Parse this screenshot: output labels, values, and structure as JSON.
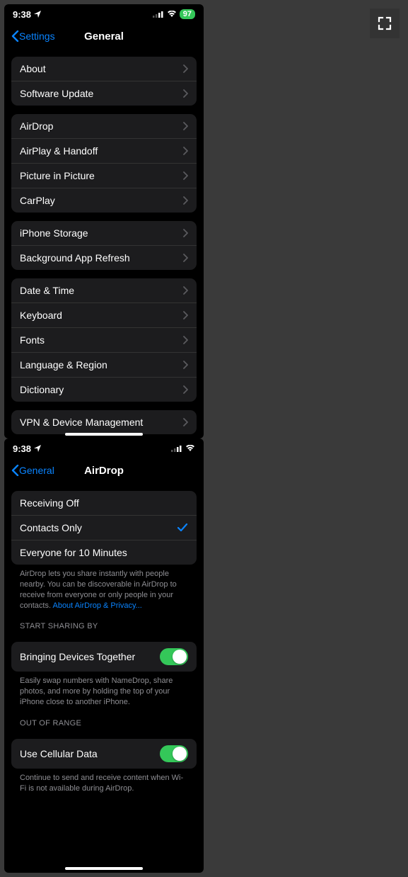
{
  "status": {
    "time": "9:38",
    "battery_pct": "97"
  },
  "left": {
    "back_label": "Settings",
    "title": "General",
    "groups": [
      {
        "rows": [
          {
            "label": "About"
          },
          {
            "label": "Software Update"
          }
        ]
      },
      {
        "rows": [
          {
            "label": "AirDrop"
          },
          {
            "label": "AirPlay & Handoff"
          },
          {
            "label": "Picture in Picture"
          },
          {
            "label": "CarPlay"
          }
        ]
      },
      {
        "rows": [
          {
            "label": "iPhone Storage"
          },
          {
            "label": "Background App Refresh"
          }
        ]
      },
      {
        "rows": [
          {
            "label": "Date & Time"
          },
          {
            "label": "Keyboard"
          },
          {
            "label": "Fonts"
          },
          {
            "label": "Language & Region"
          },
          {
            "label": "Dictionary"
          }
        ]
      },
      {
        "rows": [
          {
            "label": "VPN & Device Management"
          }
        ]
      }
    ]
  },
  "right": {
    "back_label": "General",
    "title": "AirDrop",
    "receiving": {
      "options": [
        {
          "label": "Receiving Off",
          "selected": false
        },
        {
          "label": "Contacts Only",
          "selected": true
        },
        {
          "label": "Everyone for 10 Minutes",
          "selected": false
        }
      ],
      "footer_a": "AirDrop lets you share instantly with people nearby. You can be discoverable in AirDrop to receive from everyone or only people in your contacts. ",
      "footer_link": "About AirDrop & Privacy..."
    },
    "sharing": {
      "header": "START SHARING BY",
      "toggle_label": "Bringing Devices Together",
      "footer": "Easily swap numbers with NameDrop, share photos, and more by holding the top of your iPhone close to another iPhone."
    },
    "range": {
      "header": "OUT OF RANGE",
      "toggle_label": "Use Cellular Data",
      "footer": "Continue to send and receive content when Wi-Fi is not available during AirDrop."
    }
  }
}
